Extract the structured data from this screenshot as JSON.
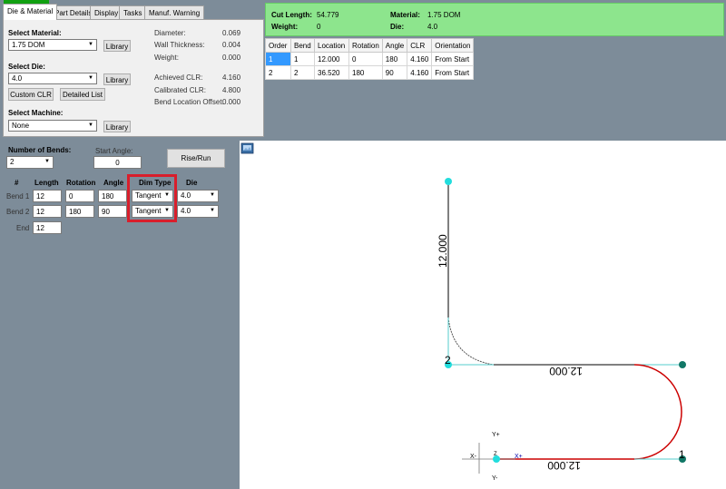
{
  "tabs": [
    "Die & Material",
    "Part Details",
    "Display",
    "Tasks",
    "Manuf. Warning"
  ],
  "die_material": {
    "select_material_label": "Select Material:",
    "material_value": "1.75 DOM",
    "select_die_label": "Select Die:",
    "die_value": "4.0",
    "select_machine_label": "Select Machine:",
    "machine_value": "None",
    "library_label": "Library",
    "custom_clr_label": "Custom CLR",
    "detailed_list_label": "Detailed List",
    "props": [
      {
        "label": "Diameter:",
        "value": "0.069"
      },
      {
        "label": "Wall Thickness:",
        "value": "0.004"
      },
      {
        "label": "Weight:",
        "value": "0.000"
      },
      {
        "label": "Achieved CLR:",
        "value": "4.160"
      },
      {
        "label": "Calibrated CLR:",
        "value": "4.800"
      },
      {
        "label": "Bend Location Offset:",
        "value": "0.000"
      }
    ]
  },
  "summary": {
    "cut_length_label": "Cut Length:",
    "cut_length_value": "54.779",
    "weight_label": "Weight:",
    "weight_value": "0",
    "material_label": "Material:",
    "material_value": "1.75 DOM",
    "die_label": "Die:",
    "die_value": "4.0"
  },
  "bend_table": {
    "headers": [
      "Order",
      "Bend",
      "Location",
      "Rotation",
      "Angle",
      "CLR",
      "Orientation"
    ],
    "rows": [
      [
        "1",
        "1",
        "12.000",
        "0",
        "180",
        "4.160",
        "From Start"
      ],
      [
        "2",
        "2",
        "36.520",
        "180",
        "90",
        "4.160",
        "From Start"
      ]
    ]
  },
  "bends": {
    "number_of_bends_label": "Number of Bends:",
    "number_of_bends_value": "2",
    "start_angle_label": "Start Angle:",
    "start_angle_value": "0",
    "rise_run_label": "Rise/Run",
    "headers": {
      "num": "#",
      "length": "Length",
      "rotation": "Rotation",
      "angle": "Angle",
      "dim_type": "Dim Type",
      "die": "Die"
    },
    "rows": [
      {
        "label": "Bend 1",
        "length": "12",
        "rotation": "0",
        "angle": "180",
        "dim_type": "Tangent",
        "die": "4.0"
      },
      {
        "label": "Bend 2",
        "length": "12",
        "rotation": "180",
        "angle": "90",
        "dim_type": "Tangent",
        "die": "4.0"
      }
    ],
    "end_label": "End",
    "end_value": "12"
  },
  "drawing": {
    "dim_vertical": "12.000",
    "dim_top": "12.000",
    "dim_bottom": "12.000",
    "node_2_label": "2",
    "node_1_label": "1",
    "axis_y_plus": "Y+",
    "axis_y_minus": "Y-",
    "axis_x_plus": "X+",
    "axis_x_minus": "X-",
    "axis_z": "Z"
  },
  "icons": [
    "dropdown-arrow-icon",
    "camera-icon"
  ],
  "colors": {
    "accent_green": "#8de58d",
    "highlight_red": "#d91e2b",
    "tube_red": "#cc0000",
    "node_cyan": "#22dddd",
    "selection_blue": "#3399ff"
  }
}
